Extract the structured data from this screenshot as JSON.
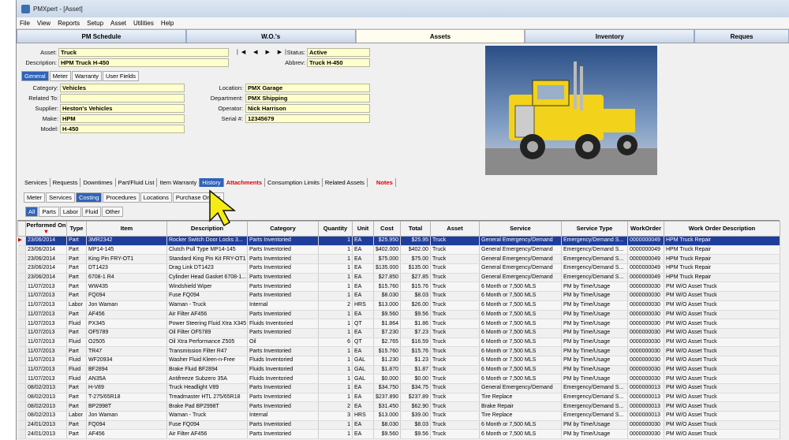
{
  "window": {
    "title": "PMXpert - [Asset]"
  },
  "menu": [
    "File",
    "View",
    "Reports",
    "Setup",
    "Asset",
    "Utilities",
    "Help"
  ],
  "main_tabs": [
    "PM Schedule",
    "W.O.'s",
    "Assets",
    "Inventory",
    "Reques"
  ],
  "header": {
    "asset_label": "Asset:",
    "asset_value": "Truck",
    "status_label": "Status:",
    "status_value": "Active",
    "description_label": "Description:",
    "description_value": "HPM Truck H-450",
    "abbrev_label": "Abbrev:",
    "abbrev_value": "Truck H-450",
    "nav": "|◀ ◀ ▶ ▶|"
  },
  "general_tabs": [
    "General",
    "Meter",
    "Warranty",
    "User Fields"
  ],
  "general": {
    "category_label": "Category:",
    "category_value": "Vehicles",
    "related_label": "Related To:",
    "related_value": "",
    "supplier_label": "Supplier:",
    "supplier_value": "Heston's Vehicles",
    "make_label": "Make:",
    "make_value": "HPM",
    "model_label": "Model:",
    "model_value": "H-450",
    "location_label": "Location:",
    "location_value": "PMX Garage",
    "department_label": "Department:",
    "department_value": "PMX Shipping",
    "operator_label": "Operator:",
    "operator_value": "Nick Harrison",
    "serial_label": "Serial #:",
    "serial_value": "12345679"
  },
  "section_tabs": [
    "Services",
    "Requests",
    "Downtimes",
    "Part/Fluid List",
    "Item Warranty",
    "History",
    "Attachments",
    "Consumption Limits",
    "Related Assets",
    "Notes"
  ],
  "history_tabs": [
    "Meter",
    "Services",
    "Costing",
    "Procedures",
    "Locations",
    "Purchase Orders"
  ],
  "filter_tabs": [
    "All",
    "Parts",
    "Labor",
    "Fluid",
    "Other"
  ],
  "columns": [
    "Performed On",
    "Type",
    "Item",
    "Description",
    "Category",
    "Quantity",
    "Unit",
    "Cost",
    "Total",
    "Asset",
    "Service",
    "Service Type",
    "WorkOrder",
    "Work Order Description"
  ],
  "rows": [
    [
      "23/06/2014",
      "Part",
      "3MR2342",
      "Rocker Switch Door Locks 3...",
      "Parts Inventoried",
      "1",
      "EA",
      "$25.950",
      "$25.95",
      "Truck",
      "General Emergency/Demand",
      "Emergency/Demand S...",
      "0000000049",
      "HPM Truck Repair"
    ],
    [
      "23/06/2014",
      "Part",
      "MP14-145",
      "Clutch Pull Type MP14-145",
      "Parts Inventoried",
      "1",
      "EA",
      "$402.000",
      "$402.00",
      "Truck",
      "General Emergency/Demand",
      "Emergency/Demand S...",
      "0000000049",
      "HPM Truck Repair"
    ],
    [
      "23/06/2014",
      "Part",
      "King Pin FRY-OT1",
      "Standard King Pin Kit FRY-OT1",
      "Parts Inventoried",
      "1",
      "EA",
      "$75.000",
      "$75.00",
      "Truck",
      "General Emergency/Demand",
      "Emergency/Demand S...",
      "0000000049",
      "HPM Truck Repair"
    ],
    [
      "23/06/2014",
      "Part",
      "DT1423",
      "Drag Link DT1423",
      "Parts Inventoried",
      "1",
      "EA",
      "$135.000",
      "$135.00",
      "Truck",
      "General Emergency/Demand",
      "Emergency/Demand S...",
      "0000000049",
      "HPM Truck Repair"
    ],
    [
      "23/06/2014",
      "Part",
      "6708-1 R4",
      "Cylinder Head Gasket 6708-1...",
      "Parts Inventoried",
      "1",
      "EA",
      "$27.850",
      "$27.85",
      "Truck",
      "General Emergency/Demand",
      "Emergency/Demand S...",
      "0000000049",
      "HPM Truck Repair"
    ],
    [
      "11/07/2013",
      "Part",
      "WW435",
      "Windshield Wiper",
      "Parts Inventoried",
      "1",
      "EA",
      "$15.760",
      "$15.76",
      "Truck",
      "6 Month or 7,500 MLS",
      "PM by Time/Usage",
      "0000000030",
      "PM W/O Asset Truck"
    ],
    [
      "11/07/2013",
      "Part",
      "FQ094",
      "Fuse FQ094",
      "Parts Inventoried",
      "1",
      "EA",
      "$8.030",
      "$8.03",
      "Truck",
      "6 Month or 7,500 MLS",
      "PM by Time/Usage",
      "0000000030",
      "PM W/O Asset Truck"
    ],
    [
      "11/07/2013",
      "Labor",
      "Jon Waman",
      "Waman - Truck",
      "Internal",
      "2",
      "HRS",
      "$13.000",
      "$26.00",
      "Truck",
      "6 Month or 7,500 MLS",
      "PM by Time/Usage",
      "0000000030",
      "PM W/O Asset Truck"
    ],
    [
      "11/07/2013",
      "Part",
      "AF456",
      "Air Filter AF456",
      "Parts Inventoried",
      "1",
      "EA",
      "$9.560",
      "$9.56",
      "Truck",
      "6 Month or 7,500 MLS",
      "PM by Time/Usage",
      "0000000030",
      "PM W/O Asset Truck"
    ],
    [
      "11/07/2013",
      "Fluid",
      "PX345",
      "Power Steering Fluid Xtra X345",
      "Fluids Inventoried",
      "1",
      "QT",
      "$1.864",
      "$1.86",
      "Truck",
      "6 Month or 7,500 MLS",
      "PM by Time/Usage",
      "0000000030",
      "PM W/O Asset Truck"
    ],
    [
      "11/07/2013",
      "Part",
      "OF5789",
      "Oil Filter OF5789",
      "Parts Inventoried",
      "1",
      "EA",
      "$7.230",
      "$7.23",
      "Truck",
      "6 Month or 7,500 MLS",
      "PM by Time/Usage",
      "0000000030",
      "PM W/O Asset Truck"
    ],
    [
      "11/07/2013",
      "Fluid",
      "O2505",
      "Oil Xtra Performance Z505",
      "Oil",
      "6",
      "QT",
      "$2.765",
      "$16.59",
      "Truck",
      "6 Month or 7,500 MLS",
      "PM by Time/Usage",
      "0000000030",
      "PM W/O Asset Truck"
    ],
    [
      "11/07/2013",
      "Part",
      "TR47",
      "Transmission Filter R47",
      "Parts Inventoried",
      "1",
      "EA",
      "$15.760",
      "$15.76",
      "Truck",
      "6 Month or 7,500 MLS",
      "PM by Time/Usage",
      "0000000030",
      "PM W/O Asset Truck"
    ],
    [
      "11/07/2013",
      "Fluid",
      "WF20934",
      "Washer Fluid Kleen-n-Free",
      "Fluids Inventoried",
      "1",
      "GAL",
      "$1.230",
      "$1.23",
      "Truck",
      "6 Month or 7,500 MLS",
      "PM by Time/Usage",
      "0000000030",
      "PM W/O Asset Truck"
    ],
    [
      "11/07/2013",
      "Fluid",
      "BF2894",
      "Brake Fluid BF2894",
      "Fluids Inventoried",
      "1",
      "GAL",
      "$1.870",
      "$1.87",
      "Truck",
      "6 Month or 7,500 MLS",
      "PM by Time/Usage",
      "0000000030",
      "PM W/O Asset Truck"
    ],
    [
      "11/07/2013",
      "Fluid",
      "AN35A",
      "Antifreeze Subzero 35A",
      "Fluids Inventoried",
      "1",
      "GAL",
      "$0.000",
      "$0.00",
      "Truck",
      "6 Month or 7,500 MLS",
      "PM by Time/Usage",
      "0000000030",
      "PM W/O Asset Truck"
    ],
    [
      "08/02/2013",
      "Part",
      "H-V89",
      "Truck Headlight V89",
      "Parts Inventoried",
      "1",
      "EA",
      "$34.750",
      "$34.75",
      "Truck",
      "General Emergency/Demand",
      "Emergency/Demand S...",
      "0000000013",
      "PM W/O Asset Truck"
    ],
    [
      "08/02/2013",
      "Part",
      "T-275/65R18",
      "Treadmaster HTL 275/65R18",
      "Parts Inventoried",
      "1",
      "EA",
      "$237.890",
      "$237.89",
      "Truck",
      "Tire Replace",
      "Emergency/Demand S...",
      "0000000013",
      "PM W/O Asset Truck"
    ],
    [
      "08/02/2013",
      "Part",
      "BP2998T",
      "Brake Pad BP2998T",
      "Parts Inventoried",
      "2",
      "EA",
      "$31.450",
      "$62.90",
      "Truck",
      "Brake Repair",
      "Emergency/Demand S...",
      "0000000013",
      "PM W/O Asset Truck"
    ],
    [
      "08/02/2013",
      "Labor",
      "Jon Waman",
      "Waman - Truck",
      "Internal",
      "3",
      "HRS",
      "$13.000",
      "$39.00",
      "Truck",
      "Tire Replace",
      "Emergency/Demand S...",
      "0000000013",
      "PM W/O Asset Truck"
    ],
    [
      "24/01/2013",
      "Part",
      "FQ094",
      "Fuse FQ094",
      "Parts Inventoried",
      "1",
      "EA",
      "$8.030",
      "$8.03",
      "Truck",
      "6 Month or 7,500 MLS",
      "PM by Time/Usage",
      "0000000030",
      "PM W/O Asset Truck"
    ],
    [
      "24/01/2013",
      "Part",
      "AF456",
      "Air Filter AF456",
      "Parts Inventoried",
      "1",
      "EA",
      "$9.560",
      "$9.56",
      "Truck",
      "6 Month or 7,500 MLS",
      "PM by Time/Usage",
      "0000000030",
      "PM W/O Asset Truck"
    ]
  ]
}
